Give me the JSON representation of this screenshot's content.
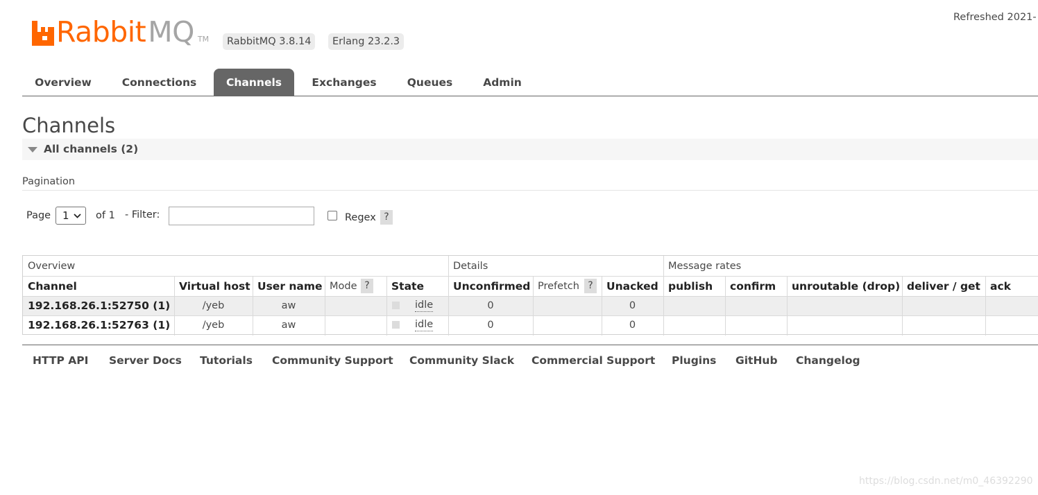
{
  "header": {
    "logo_rabbit": "Rabbit",
    "logo_mq": "MQ",
    "logo_tm": "TM",
    "version_rabbitmq": "RabbitMQ 3.8.14",
    "version_erlang": "Erlang 23.2.3",
    "refreshed": "Refreshed 2021-"
  },
  "tabs": [
    "Overview",
    "Connections",
    "Channels",
    "Exchanges",
    "Queues",
    "Admin"
  ],
  "active_tab": "Channels",
  "page": {
    "title": "Channels",
    "section_label": "All channels (2)"
  },
  "pagination": {
    "label": "Pagination",
    "page_label": "Page",
    "page_value": "1",
    "of_label": "of 1",
    "filter_label": "- Filter:",
    "filter_value": "",
    "regex_label": "Regex",
    "regex_checked": false,
    "help": "?"
  },
  "table": {
    "groups": [
      "Overview",
      "Details",
      "Message rates"
    ],
    "headers": {
      "channel": "Channel",
      "vhost": "Virtual host",
      "user": "User name",
      "mode": "Mode",
      "state": "State",
      "unconfirmed": "Unconfirmed",
      "prefetch": "Prefetch",
      "unacked": "Unacked",
      "publish": "publish",
      "confirm": "confirm",
      "unroutable": "unroutable (drop)",
      "deliver": "deliver / get",
      "ack": "ack"
    },
    "help": "?",
    "rows": [
      {
        "channel": "192.168.26.1:52750 (1)",
        "vhost": "/yeb",
        "user": "aw",
        "mode": "",
        "state": "idle",
        "unconfirmed": "0",
        "prefetch": "",
        "unacked": "0"
      },
      {
        "channel": "192.168.26.1:52763 (1)",
        "vhost": "/yeb",
        "user": "aw",
        "mode": "",
        "state": "idle",
        "unconfirmed": "0",
        "prefetch": "",
        "unacked": "0"
      }
    ]
  },
  "footer": [
    "HTTP API",
    "Server Docs",
    "Tutorials",
    "Community Support",
    "Community Slack",
    "Commercial Support",
    "Plugins",
    "GitHub",
    "Changelog"
  ],
  "watermark": "https://blog.csdn.net/m0_46392290",
  "colors": {
    "brand_orange": "#ff6600",
    "logo_grey": "#a5a5a5",
    "active_tab_bg": "#666666",
    "text": "#484848",
    "row_alt_bg": "#eeeeee"
  }
}
